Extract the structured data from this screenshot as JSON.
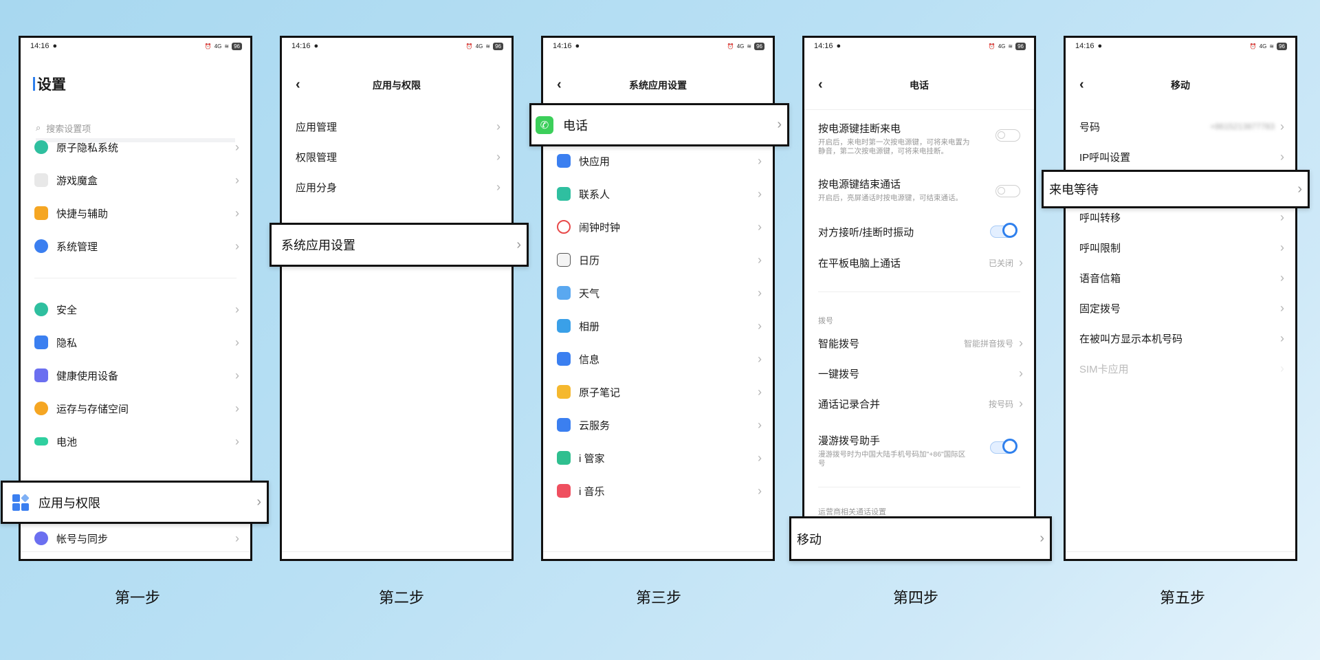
{
  "steps": [
    "第一步",
    "第二步",
    "第三步",
    "第四步",
    "第五步"
  ],
  "status": {
    "time": "14:16",
    "battery": "96",
    "net": "4G"
  },
  "phone1": {
    "title": "设置",
    "search_placeholder": "搜索设置项",
    "items": [
      {
        "label": "原子隐私系统",
        "color": "#2fbf9f"
      },
      {
        "label": "游戏魔盒",
        "color": "#e0e0e0"
      },
      {
        "label": "快捷与辅助",
        "color": "#f5a623"
      },
      {
        "label": "系统管理",
        "color": "#3b7ff0"
      },
      {
        "label": "安全",
        "color": "#2fbf9f"
      },
      {
        "label": "隐私",
        "color": "#3b7ff0"
      },
      {
        "label": "健康使用设备",
        "color": "#6b6ff0"
      },
      {
        "label": "运存与存储空间",
        "color": "#f5a623"
      },
      {
        "label": "电池",
        "color": "#2fcf9f"
      },
      {
        "label": "帐号与同步",
        "color": "#6b6ff0"
      }
    ],
    "callout": "应用与权限"
  },
  "phone2": {
    "title": "应用与权限",
    "items": [
      "应用管理",
      "权限管理",
      "应用分身"
    ],
    "callout": "系统应用设置"
  },
  "phone3": {
    "title": "系统应用设置",
    "callout": "电话",
    "items": [
      {
        "label": "快应用",
        "color": "#3b7ff0"
      },
      {
        "label": "联系人",
        "color": "#2fbfa0"
      },
      {
        "label": "闹钟时钟",
        "color": "#e84a4a"
      },
      {
        "label": "日历",
        "color": "#555555"
      },
      {
        "label": "天气",
        "color": "#5aa8f0"
      },
      {
        "label": "相册",
        "color": "#3aa0e8"
      },
      {
        "label": "信息",
        "color": "#3b7ff0"
      },
      {
        "label": "原子笔记",
        "color": "#f5b82e"
      },
      {
        "label": "云服务",
        "color": "#3b7ff0"
      },
      {
        "label": "i 管家",
        "color": "#2fbf8f"
      },
      {
        "label": "i 音乐",
        "color": "#ef4f5f"
      }
    ]
  },
  "phone4": {
    "title": "电话",
    "r1": {
      "label": "按电源键挂断来电",
      "sub": "开启后，来电时第一次按电源键，可将来电置为静音，第二次按电源键，可将来电挂断。"
    },
    "r2": {
      "label": "按电源键结束通话",
      "sub": "开启后，亮屏通话时按电源键，可结束通话。"
    },
    "r3": {
      "label": "对方接听/挂断时振动"
    },
    "r4": {
      "label": "在平板电脑上通话",
      "value": "已关闭"
    },
    "section_dial": "拨号",
    "r5": {
      "label": "智能拨号",
      "value": "智能拼音拨号"
    },
    "r6": {
      "label": "一键拨号"
    },
    "r7": {
      "label": "通话记录合并",
      "value": "按号码"
    },
    "r8": {
      "label": "漫游拨号助手",
      "sub": "漫游拨号时为中国大陆手机号码加\"+86\"国际区号"
    },
    "section_carrier": "运营商相关通话设置",
    "callout": "移动"
  },
  "phone5": {
    "title": "移动",
    "number_label": "号码",
    "number_value": "+8615213877783",
    "items_top": [
      "IP呼叫设置"
    ],
    "callout": "来电等待",
    "items": [
      "呼叫转移",
      "呼叫限制",
      "语音信箱",
      "固定拨号",
      "在被叫方显示本机号码"
    ],
    "disabled": "SIM卡应用"
  }
}
